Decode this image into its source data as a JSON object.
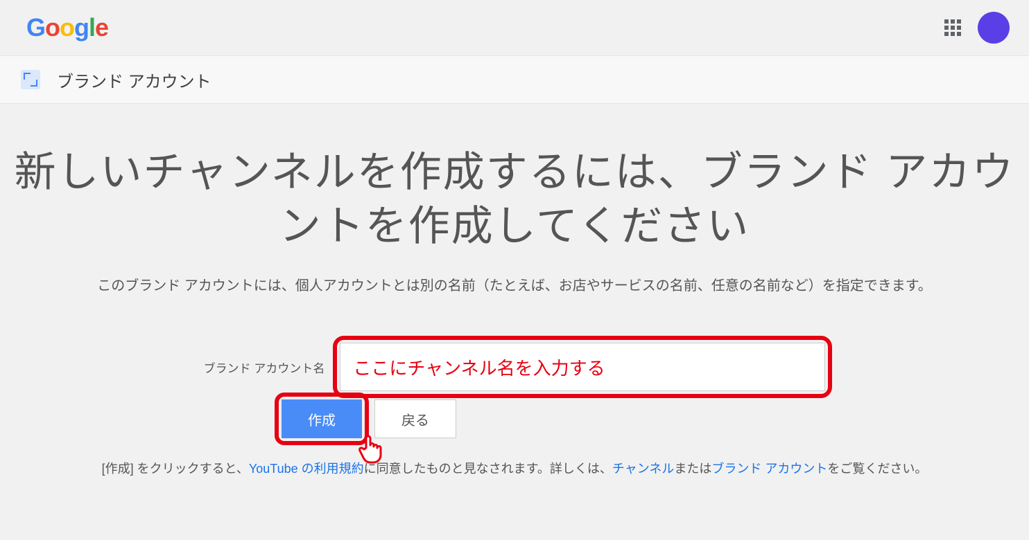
{
  "header": {
    "logo_letters": [
      "G",
      "o",
      "o",
      "g",
      "l",
      "e"
    ],
    "apps_icon_name": "apps-icon",
    "avatar_color": "#5B3FE6"
  },
  "sub_header": {
    "title": "ブランド アカウント"
  },
  "main": {
    "title": "新しいチャンネルを作成するには、ブランド アカウントを作成してください",
    "description": "このブランド アカウントには、個人アカウントとは別の名前（たとえば、お店やサービスの名前、任意の名前など）を指定できます。"
  },
  "form": {
    "label": "ブランド アカウント名",
    "input_value": "ここにチャンネル名を入力する",
    "create_button": "作成",
    "back_button": "戻る"
  },
  "terms": {
    "prefix": "[作成] をクリックすると、",
    "link1": "YouTube の利用規約",
    "mid": "に同意したものと見なされます。詳しくは、",
    "link2": "チャンネル",
    "or": "または",
    "link3": "ブランド アカウント",
    "suffix": "をご覧ください。"
  },
  "annotations": {
    "input_highlight": true,
    "button_highlight": true,
    "cursor_overlay": true
  }
}
